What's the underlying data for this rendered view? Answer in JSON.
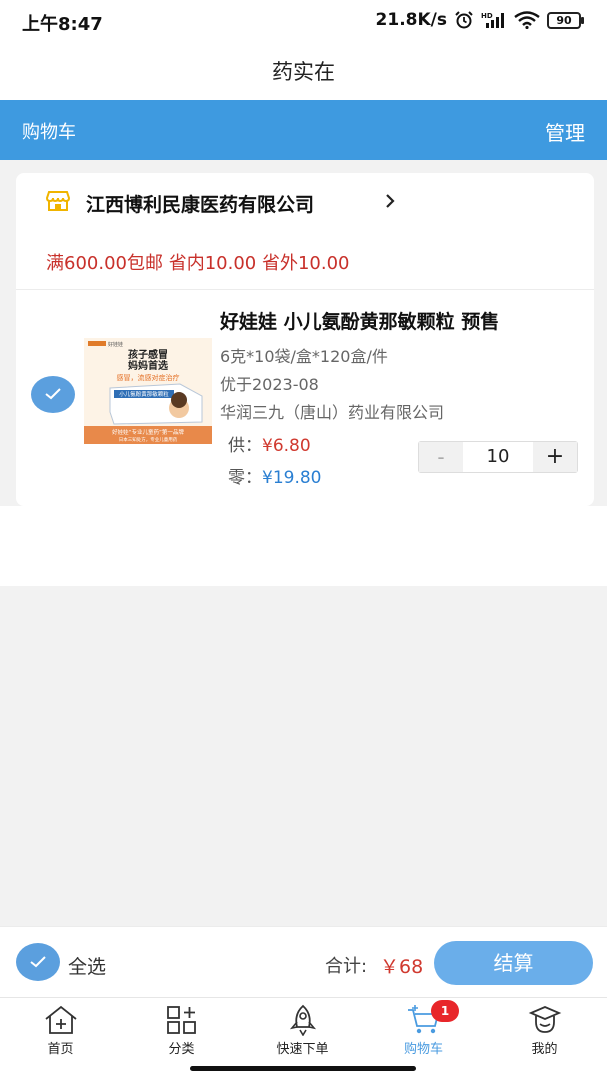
{
  "status_bar": {
    "time": "上午8:47",
    "net_speed": "21.8K/s",
    "battery": "90",
    "icons": [
      "alarm-icon",
      "hd-signal-icon",
      "wifi-icon",
      "battery-icon"
    ]
  },
  "app_title": "药实在",
  "header": {
    "title": "购物车",
    "manage": "管理"
  },
  "store": {
    "name": "江西博利民康医药有限公司",
    "icon": "store-icon",
    "promo": "满600.00包邮 省内10.00 省外10.00"
  },
  "product": {
    "name": "好娃娃 小儿氨酚黄那敏颗粒 预售",
    "spec": "6克*10袋/盒*120盒/件",
    "date": "优于2023-08",
    "maker": "华润三九（唐山）药业有限公司",
    "supply_label": "供：",
    "supply_price": "¥6.80",
    "retail_label": "零：",
    "retail_price": "¥19.80",
    "quantity": "10",
    "minus": "-",
    "plus": "+",
    "image": {
      "brand": "好娃娃",
      "headline_1": "孩子感冒",
      "headline_2": "妈妈首选",
      "tagline": "感冒，流感对症治疗",
      "box_label": "小儿氨酚黄那敏颗粒",
      "footer": "好娃娃“专业儿童药”第一品牌",
      "subfooter": "日本三知处方，专业儿童用药"
    }
  },
  "bottom_bar": {
    "select_all": "全选",
    "total_label": "合计:",
    "total_value": "￥68",
    "checkout": "结算"
  },
  "tabs": [
    {
      "label": "首页",
      "icon": "home-icon"
    },
    {
      "label": "分类",
      "icon": "category-icon"
    },
    {
      "label": "快速下单",
      "icon": "rocket-icon"
    },
    {
      "label": "购物车",
      "icon": "cart-icon",
      "active": true,
      "badge": "1"
    },
    {
      "label": "我的",
      "icon": "profile-icon"
    }
  ],
  "colors": {
    "header_bg": "#3e9ae0",
    "accent_blue": "#5b9fde",
    "price_red": "#d0392f",
    "retail_blue": "#2a7fd2",
    "promo_red": "#c8312b",
    "store_icon": "#f0b400",
    "badge_red": "#e8262a"
  }
}
